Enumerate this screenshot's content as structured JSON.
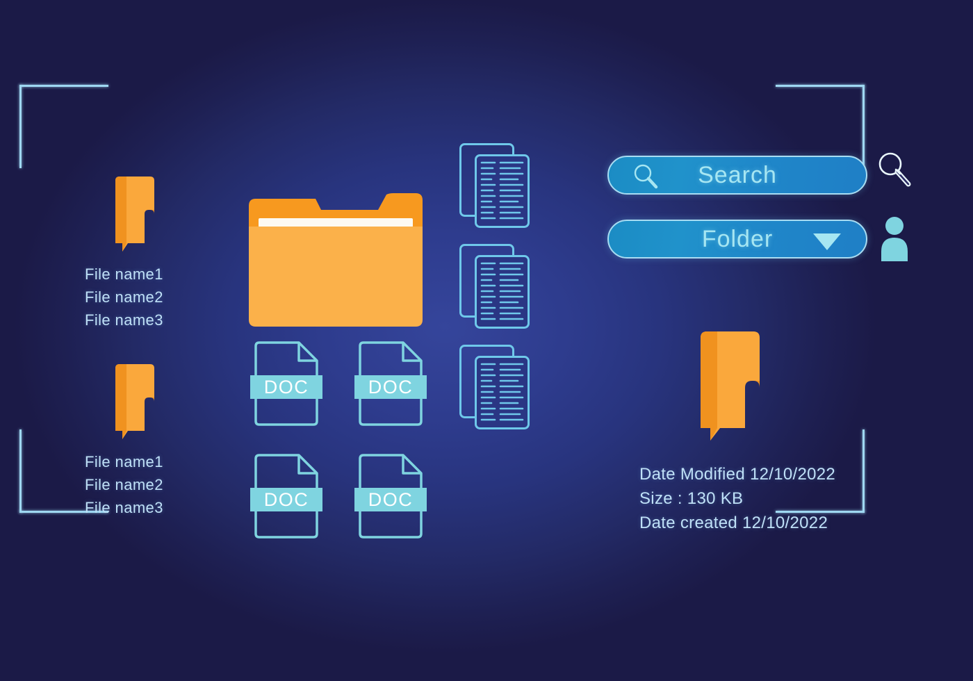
{
  "theme": {
    "bg_dark": "#1d1b4d",
    "bg_center": "#35459b",
    "accent_orange": "#faa83c",
    "accent_orange_dark": "#f59324",
    "accent_cyan": "#7fd4e0",
    "text_light": "#bfe0f7",
    "bar_blue": "#1f8cc7",
    "bar_border": "#a8dcf2"
  },
  "frame": {
    "corner_bracket_name": "corner-bracket"
  },
  "file_groups": [
    {
      "id": "group-1",
      "icon": "bookmark-file-icon",
      "files": [
        "File name1",
        "File name2",
        "File name3"
      ]
    },
    {
      "id": "group-2",
      "icon": "bookmark-file-icon",
      "files": [
        "File name1",
        "File name2",
        "File name3"
      ]
    }
  ],
  "folder": {
    "icon": "folder-icon",
    "label": ""
  },
  "doc_icons": [
    {
      "label": "DOC"
    },
    {
      "label": "DOC"
    },
    {
      "label": "DOC"
    },
    {
      "label": "DOC"
    }
  ],
  "doc_stacks": [
    {
      "name": "document-stack-1"
    },
    {
      "name": "document-stack-2"
    },
    {
      "name": "document-stack-3"
    }
  ],
  "controls": {
    "search": {
      "label": "Search",
      "placeholder": "Search",
      "icon": "search-icon"
    },
    "folder_select": {
      "label": "Folder",
      "icon": "chevron-down-icon",
      "options": [
        "Folder"
      ]
    },
    "search_side_icon": "magnifier-icon",
    "user_side_icon": "user-icon"
  },
  "details": {
    "icon": "bookmark-file-icon",
    "rows": [
      "Date Modified  12/10/2022",
      "Size : 130 KB",
      "Date created   12/10/2022"
    ],
    "date_modified_label": "Date Modified",
    "date_modified_value": "12/10/2022",
    "size_label": "Size :",
    "size_value": "130 KB",
    "date_created_label": "Date created",
    "date_created_value": "12/10/2022"
  }
}
